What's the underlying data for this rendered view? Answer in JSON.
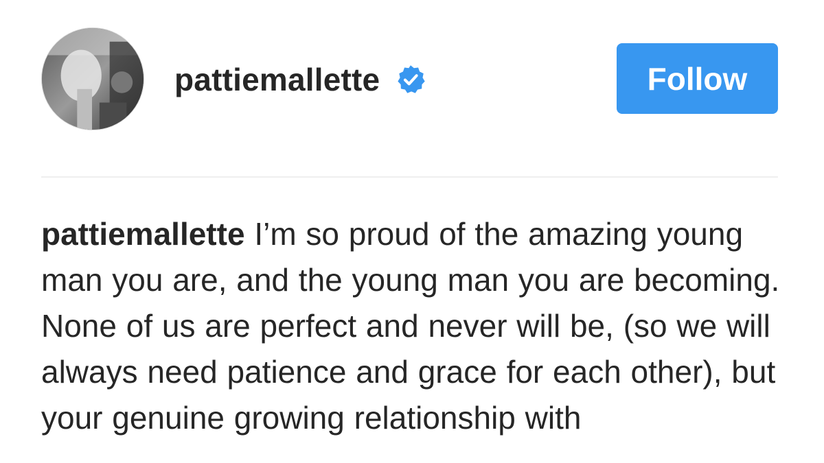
{
  "post": {
    "author": {
      "username": "pattiemallette",
      "verified": true,
      "verified_icon": "verified-badge-icon"
    },
    "follow_button": {
      "label": "Follow"
    },
    "caption": {
      "author": "pattiemallette",
      "text": "I’m so proud of the amazing young man you are, and the young man you are becoming. None of us are perfect and never will be, (so we will always need patience and grace for each other), but your genuine growing relationship with"
    }
  },
  "colors": {
    "follow_button_bg": "#3897f0",
    "verified_badge": "#3897f0",
    "text": "#262626",
    "divider": "#efefef"
  }
}
